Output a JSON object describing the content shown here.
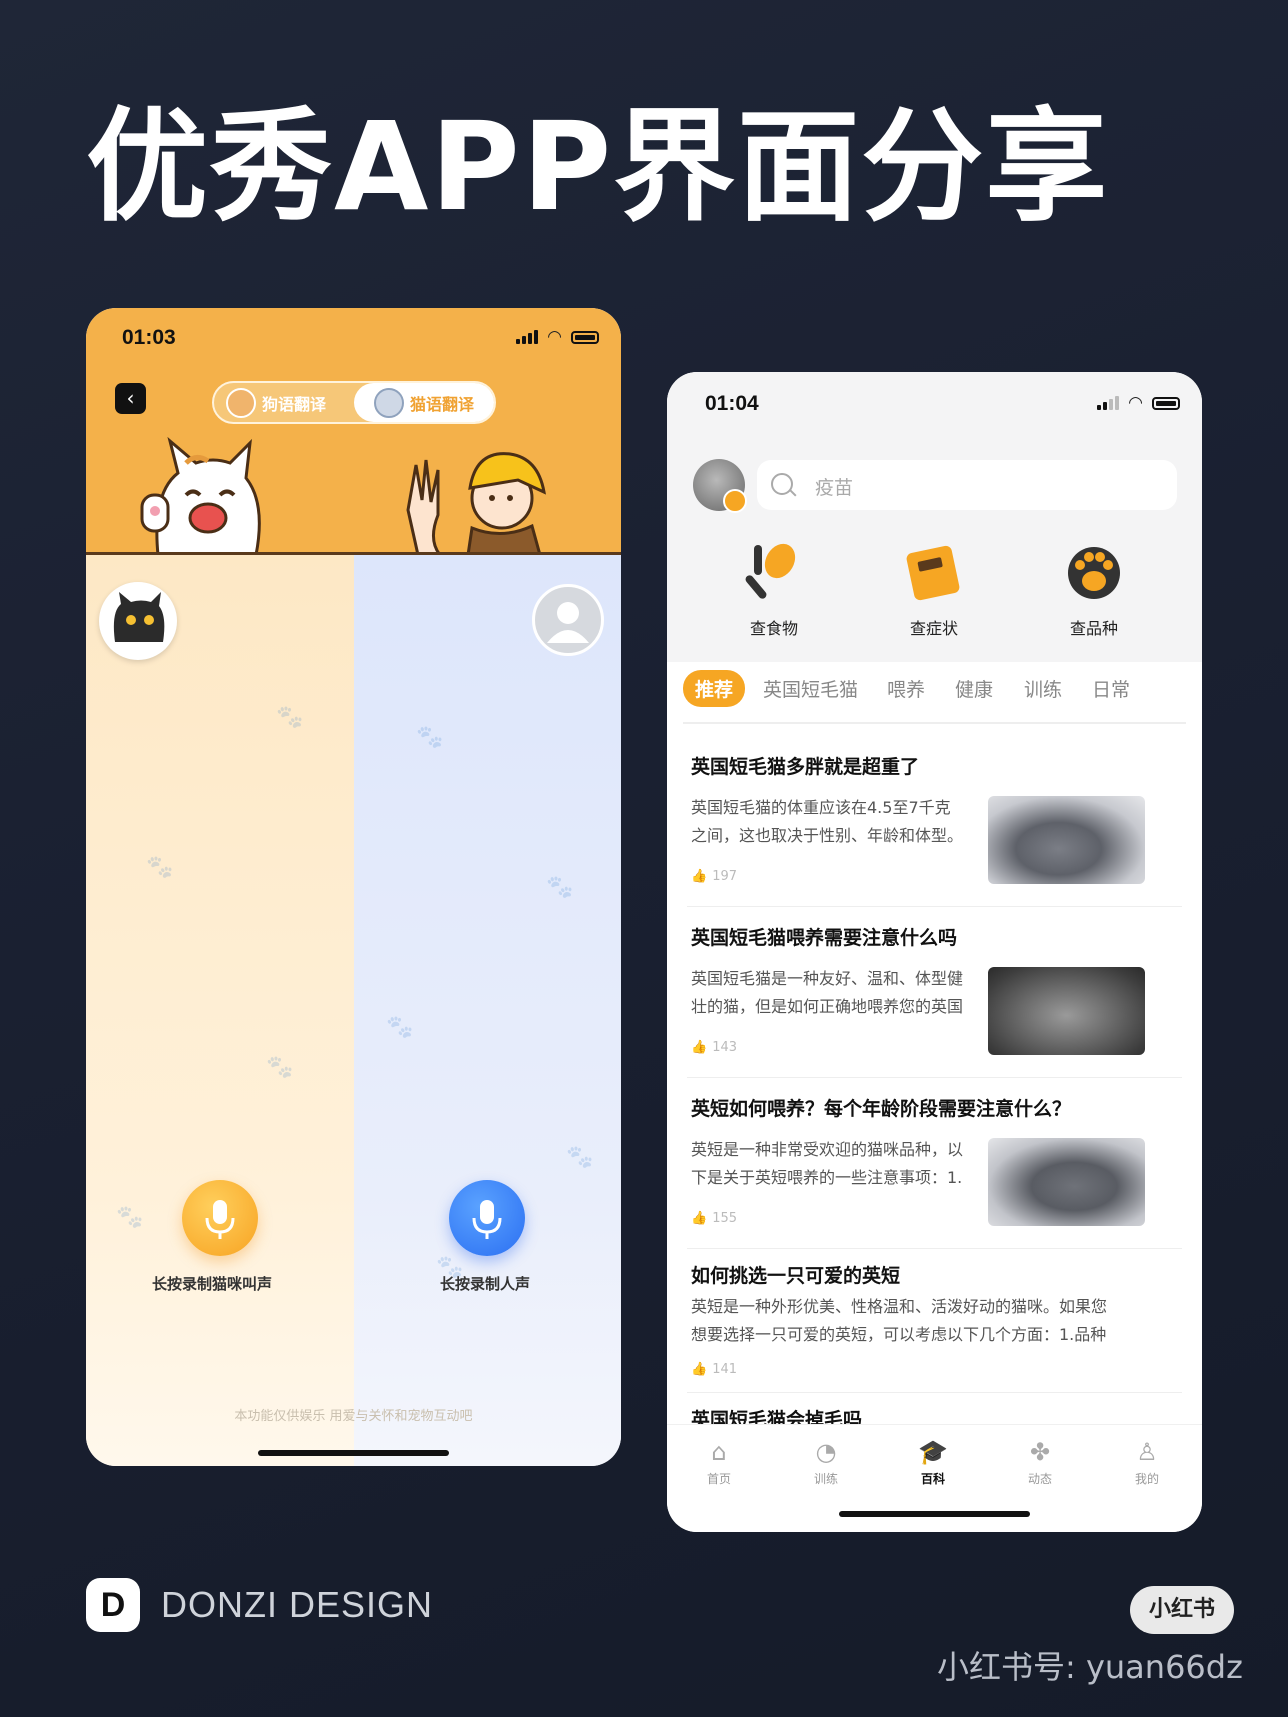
{
  "headline": "优秀APP界面分享",
  "left_app": {
    "status_time": "01:03",
    "toggle": {
      "dog": "狗语翻译",
      "cat": "猫语翻译",
      "active": "猫语翻译"
    },
    "record_cat_label": "长按录制猫咪叫声",
    "record_human_label": "长按录制人声",
    "disclaimer": "本功能仅供娱乐 用爱与关怀和宠物互动吧",
    "colors": {
      "header": "#f4b14a",
      "cat_side": "#fde8c5",
      "human_side": "#dde6fb",
      "cat_mic": "#f7a322",
      "human_mic": "#2b6ff2"
    }
  },
  "right_app": {
    "status_time": "01:04",
    "search_placeholder": "疫苗",
    "quick_actions": [
      {
        "label": "查食物",
        "icon": "food-icon"
      },
      {
        "label": "查症状",
        "icon": "symptom-book-icon"
      },
      {
        "label": "查品种",
        "icon": "paw-icon"
      }
    ],
    "tabs": [
      "推荐",
      "英国短毛猫",
      "喂养",
      "健康",
      "训练",
      "日常"
    ],
    "active_tab": "推荐",
    "articles": [
      {
        "title": "英国短毛猫多胖就是超重了",
        "excerpt_lines": [
          "英国短毛猫的体重应该在4.5至7千克",
          "之间，这也取决于性别、年龄和体型。"
        ],
        "likes": "197"
      },
      {
        "title": "英国短毛猫喂养需要注意什么吗",
        "excerpt_lines": [
          "英国短毛猫是一种友好、温和、体型健",
          "壮的猫，但是如何正确地喂养您的英国"
        ],
        "likes": "143"
      },
      {
        "title": "英短如何喂养？每个年龄阶段需要注意什么？",
        "excerpt_lines": [
          "英短是一种非常受欢迎的猫咪品种，以",
          "下是关于英短喂养的一些注意事项：1."
        ],
        "likes": "155"
      },
      {
        "title": "如何挑选一只可爱的英短",
        "excerpt_lines": [
          "英短是一种外形优美、性格温和、活泼好动的猫咪。如果您",
          "想要选择一只可爱的英短，可以考虑以下几个方面：1.品种"
        ],
        "likes": "141"
      },
      {
        "title": "英国短毛猫会掉毛吗",
        "excerpt_lines": [],
        "likes": ""
      }
    ],
    "bottom_nav": [
      {
        "label": "首页",
        "icon": "home-icon"
      },
      {
        "label": "训练",
        "icon": "chart-icon"
      },
      {
        "label": "百科",
        "icon": "graduation-cap-icon"
      },
      {
        "label": "动态",
        "icon": "pinwheel-icon"
      },
      {
        "label": "我的",
        "icon": "user-icon"
      }
    ],
    "active_nav": "百科",
    "colors": {
      "accent": "#f6a623"
    }
  },
  "footer": {
    "logo_letter": "D",
    "brand": "DONZI DESIGN",
    "badge": "小红书",
    "account": "小红书号: yuan66dz"
  }
}
